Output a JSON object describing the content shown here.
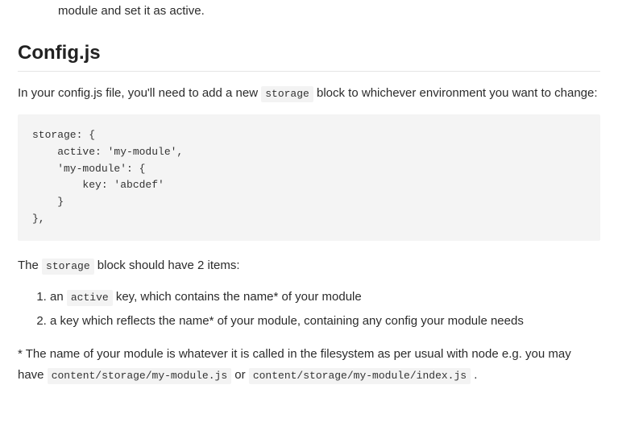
{
  "top_fragment": "module and set it as active.",
  "heading": "Config.js",
  "intro_pre": "In your config.js file, you'll need to add a new ",
  "intro_code": "storage",
  "intro_post": " block to whichever environment you want to change:",
  "codeblock": "storage: {\n    active: 'my-module',\n    'my-module': {\n        key: 'abcdef'\n    }\n},",
  "after_code_pre": "The ",
  "after_code_code": "storage",
  "after_code_post": " block should have 2 items:",
  "list": {
    "item1_pre": "an ",
    "item1_code": "active",
    "item1_post": " key, which contains the name* of your module",
    "item2": "a key which reflects the name* of your module, containing any config your module needs"
  },
  "footnote_pre": "* The name of your module is whatever it is called in the filesystem as per usual with node e.g. you may have ",
  "footnote_code1": "content/storage/my-module.js",
  "footnote_mid": " or ",
  "footnote_code2": "content/storage/my-module/index.js",
  "footnote_post": " ."
}
